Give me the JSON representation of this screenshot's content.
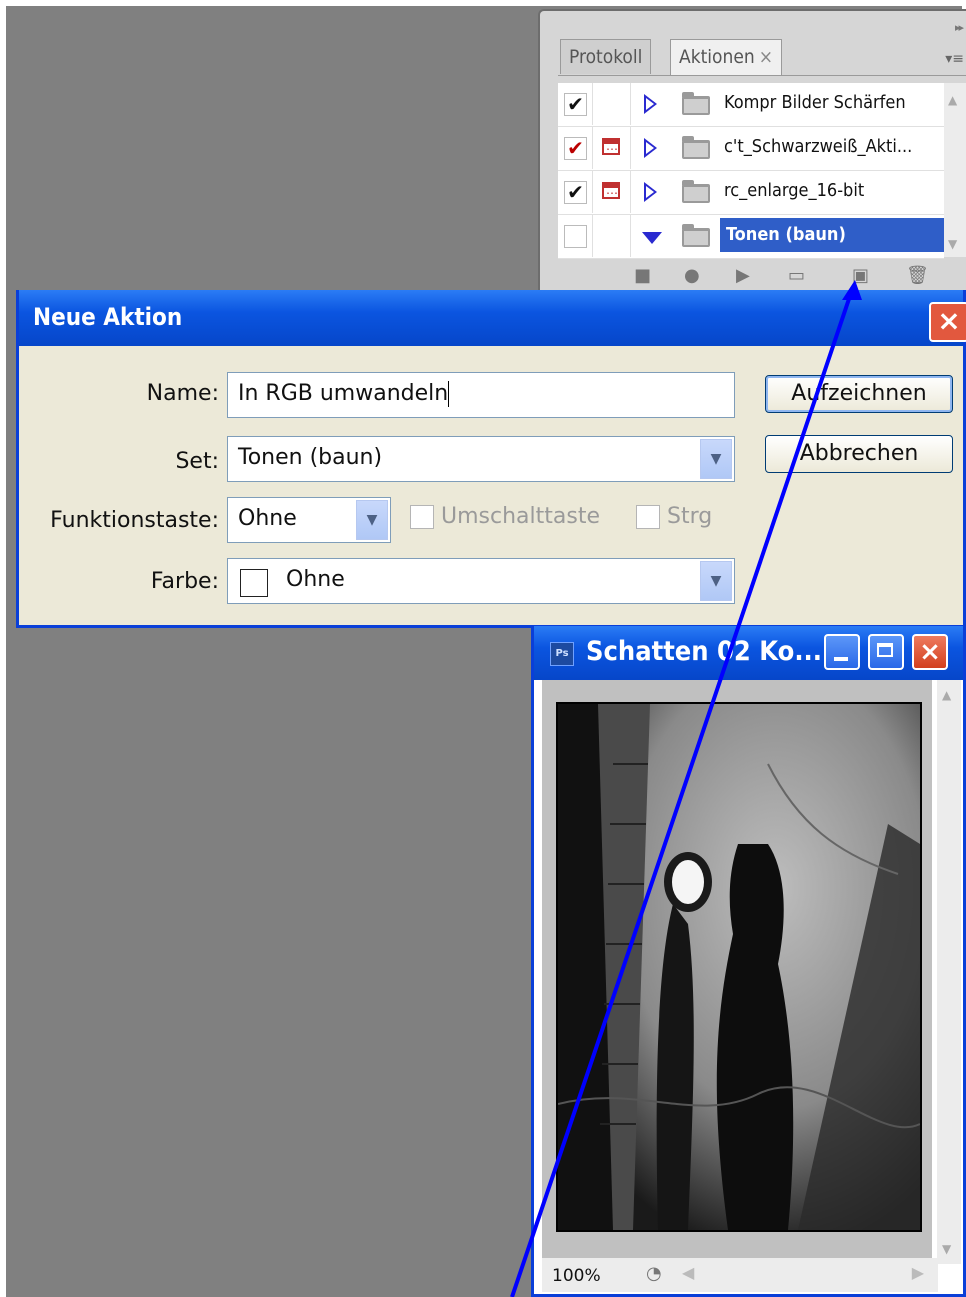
{
  "actions_panel": {
    "tabs": [
      {
        "label": "Protokoll",
        "active": false
      },
      {
        "label": "Aktionen",
        "close_glyph": "×",
        "active": true
      }
    ],
    "menu_glyph": "▾≡",
    "items": [
      {
        "label": "Kompr Bilder Schärfen",
        "checked": true,
        "check_color": "#111111",
        "dialog_icon": false,
        "expanded": false,
        "selected": false
      },
      {
        "label": "c't_Schwarzweiß_Akti...",
        "checked": true,
        "check_color": "#bb0000",
        "dialog_icon": true,
        "expanded": false,
        "selected": false
      },
      {
        "label": "rc_enlarge_16-bit",
        "checked": true,
        "check_color": "#111111",
        "dialog_icon": true,
        "expanded": false,
        "selected": false
      },
      {
        "label": "Tonen (baun)",
        "checked": false,
        "dialog_icon": false,
        "expanded": true,
        "selected": true
      }
    ],
    "footer_icons": [
      "stop-icon",
      "record-icon",
      "play-icon",
      "new-set-folder-icon",
      "new-action-icon",
      "trash-icon"
    ]
  },
  "dialog": {
    "title": "Neue Aktion",
    "name_label": "Name:",
    "name_value": "In RGB umwandeln",
    "set_label": "Set:",
    "set_value": "Tonen (baun)",
    "fkey_label": "Funktionstaste:",
    "fkey_value": "Ohne",
    "shift_label": "Umschalttaste",
    "ctrl_label": "Strg",
    "color_label": "Farbe:",
    "color_value": "Ohne",
    "record_button": "Aufzeichnen",
    "cancel_button": "Abbrechen"
  },
  "image_window": {
    "title": "Schatten 02 Ko...",
    "app_icon_text": "Ps",
    "zoom": "100%"
  },
  "annotation": {
    "arrow_color": "#0000ff"
  },
  "colors": {
    "workspace": "#808080",
    "xp_title": "#0b55e0",
    "selection": "#2f5ec8"
  }
}
